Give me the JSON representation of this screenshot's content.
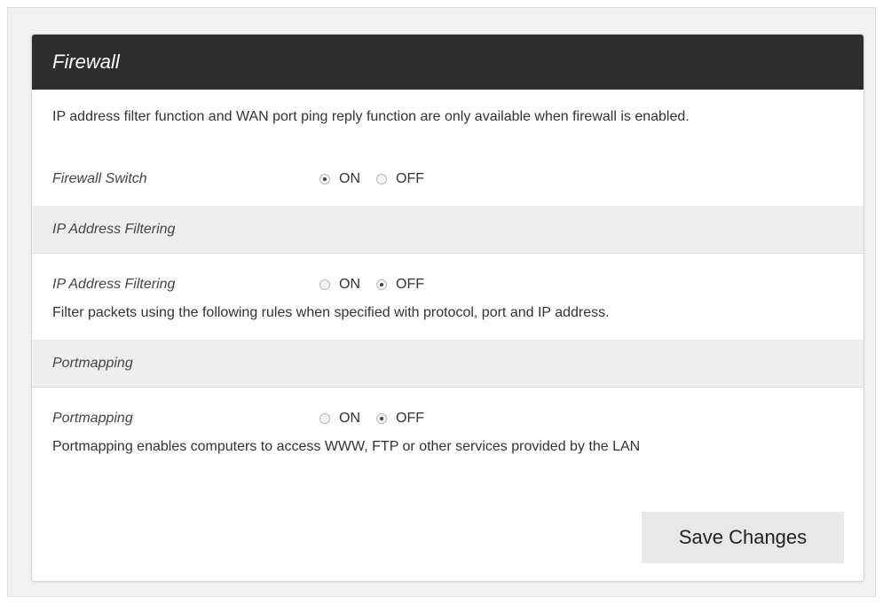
{
  "panel": {
    "title": "Firewall",
    "intro": "IP address filter function and WAN port ping reply function are only available when firewall is enabled."
  },
  "firewall_switch": {
    "label": "Firewall Switch",
    "on_label": "ON",
    "off_label": "OFF",
    "selected": "ON"
  },
  "ip_filtering": {
    "section_title": "IP Address Filtering",
    "label": "IP Address Filtering",
    "on_label": "ON",
    "off_label": "OFF",
    "selected": "OFF",
    "description": "Filter packets using the following rules when specified with protocol, port and IP address."
  },
  "portmapping": {
    "section_title": "Portmapping",
    "label": "Portmapping",
    "on_label": "ON",
    "off_label": "OFF",
    "selected": "OFF",
    "description": "Portmapping enables computers to access WWW, FTP or other services provided by the LAN"
  },
  "actions": {
    "save_label": "Save Changes"
  },
  "colors": {
    "header_bg": "#2e2e2e",
    "section_bg": "#eeeeee",
    "button_bg": "#e8e8e8"
  }
}
